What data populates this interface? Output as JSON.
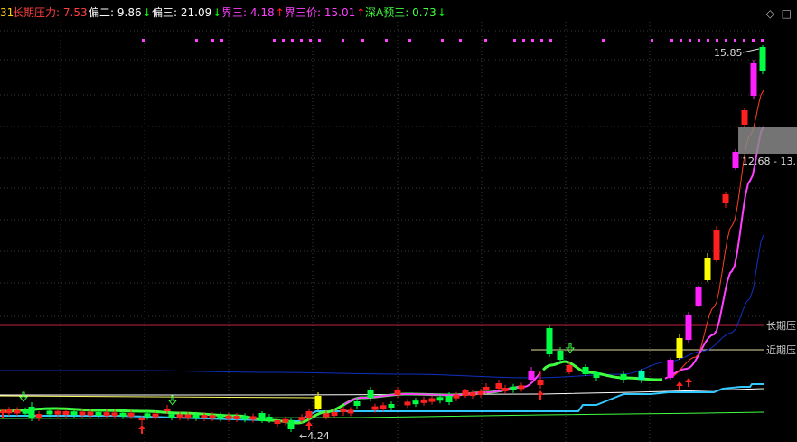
{
  "header": {
    "items": [
      {
        "label": "31",
        "value": "",
        "arrow": "",
        "color": "#ffd400",
        "label_color": "#ffd400"
      },
      {
        "label": "长期压力:",
        "value": "7.53",
        "arrow": "",
        "color": "#ff4040",
        "label_color": "#ff4040"
      },
      {
        "label": "偏二:",
        "value": "9.86",
        "arrow": "↓",
        "color": "#ffffff",
        "label_color": "#ffffff",
        "arrow_color": "#00ff00"
      },
      {
        "label": "偏三:",
        "value": "21.09",
        "arrow": "↓",
        "color": "#ffffff",
        "label_color": "#ffffff",
        "arrow_color": "#00ff00"
      },
      {
        "label": "界三:",
        "value": "4.18",
        "arrow": "↑",
        "color": "#ff40ff",
        "label_color": "#ff40ff",
        "arrow_color": "#ff2020"
      },
      {
        "label": "界三价:",
        "value": "15.01",
        "arrow": "↑",
        "color": "#ff40ff",
        "label_color": "#ff40ff",
        "arrow_color": "#ff2020"
      },
      {
        "label": "深A预三:",
        "value": "0.73",
        "arrow": "↓",
        "color": "#40ff40",
        "label_color": "#40ff40",
        "arrow_color": "#00ff00"
      }
    ],
    "tools": [
      "◇",
      "□"
    ]
  },
  "annotations": {
    "high_label": "15.85",
    "low_label": "4.24",
    "range_label": "12.68 - 13.",
    "long_pressure_label": "长期压",
    "near_pressure_label": "近期压"
  },
  "colors": {
    "background": "#000000",
    "grid": "#3a3a3a",
    "long_pressure_line": "#c02040",
    "near_pressure_line": "#e0e0a0",
    "blue_line": "#1030c0",
    "cyan_line": "#30c8ff",
    "white_line": "#ffffff",
    "green_line": "#40ff40",
    "magenta_line": "#ff40ff",
    "red_line": "#ff4020",
    "up_candle": "#ff2020",
    "down_candle": "#00ff40",
    "highlight_candle": "#ff20ff",
    "yellow_candle": "#ffff00",
    "signal_dots": "#ff40ff",
    "range_box": "#888888"
  }
}
